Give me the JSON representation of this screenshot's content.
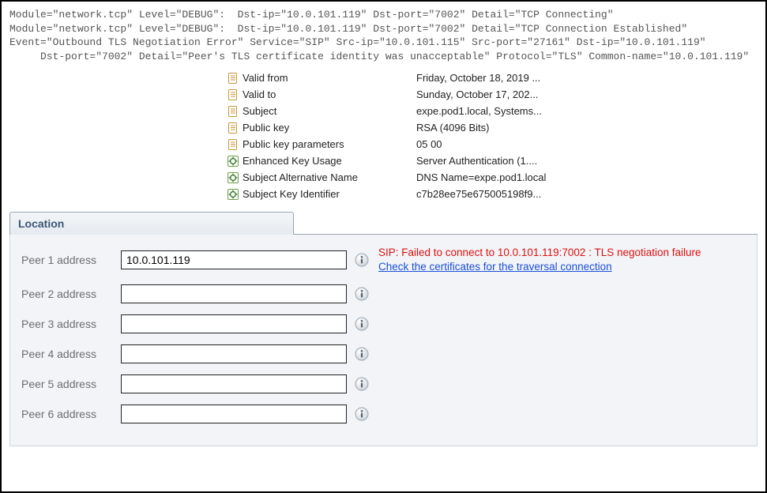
{
  "log": {
    "line1": "Module=\"network.tcp\" Level=\"DEBUG\":  Dst-ip=\"10.0.101.119\" Dst-port=\"7002\" Detail=\"TCP Connecting\"",
    "line2": "Module=\"network.tcp\" Level=\"DEBUG\":  Dst-ip=\"10.0.101.119\" Dst-port=\"7002\" Detail=\"TCP Connection Established\"",
    "line3": "Event=\"Outbound TLS Negotiation Error\" Service=\"SIP\" Src-ip=\"10.0.101.115\" Src-port=\"27161\" Dst-ip=\"10.0.101.119\"",
    "line4": "     Dst-port=\"7002\" Detail=\"Peer's TLS certificate identity was unacceptable\" Protocol=\"TLS\" Common-name=\"10.0.101.119\""
  },
  "cert": {
    "rows": [
      {
        "icon": "doc",
        "label": "Valid from",
        "value": "Friday, October 18, 2019 ..."
      },
      {
        "icon": "doc",
        "label": "Valid to",
        "value": "Sunday, October 17, 202..."
      },
      {
        "icon": "doc",
        "label": "Subject",
        "value": "expe.pod1.local, Systems..."
      },
      {
        "icon": "doc",
        "label": "Public key",
        "value": "RSA (4096 Bits)"
      },
      {
        "icon": "doc",
        "label": "Public key parameters",
        "value": "05 00"
      },
      {
        "icon": "ext",
        "label": "Enhanced Key Usage",
        "value": "Server Authentication (1...."
      },
      {
        "icon": "ext",
        "label": "Subject Alternative Name",
        "value": "DNS Name=expe.pod1.local"
      },
      {
        "icon": "ext",
        "label": "Subject Key Identifier",
        "value": "c7b28ee75e675005198f9..."
      }
    ]
  },
  "section": {
    "title": "Location"
  },
  "peers": [
    {
      "label": "Peer 1 address",
      "value": "10.0.101.119"
    },
    {
      "label": "Peer 2 address",
      "value": ""
    },
    {
      "label": "Peer 3 address",
      "value": ""
    },
    {
      "label": "Peer 4 address",
      "value": ""
    },
    {
      "label": "Peer 5 address",
      "value": ""
    },
    {
      "label": "Peer 6 address",
      "value": ""
    }
  ],
  "error": {
    "line1": "SIP: Failed to connect to 10.0.101.119:7002 : TLS negotiation failure",
    "link": "Check the certificates for the traversal connection"
  }
}
